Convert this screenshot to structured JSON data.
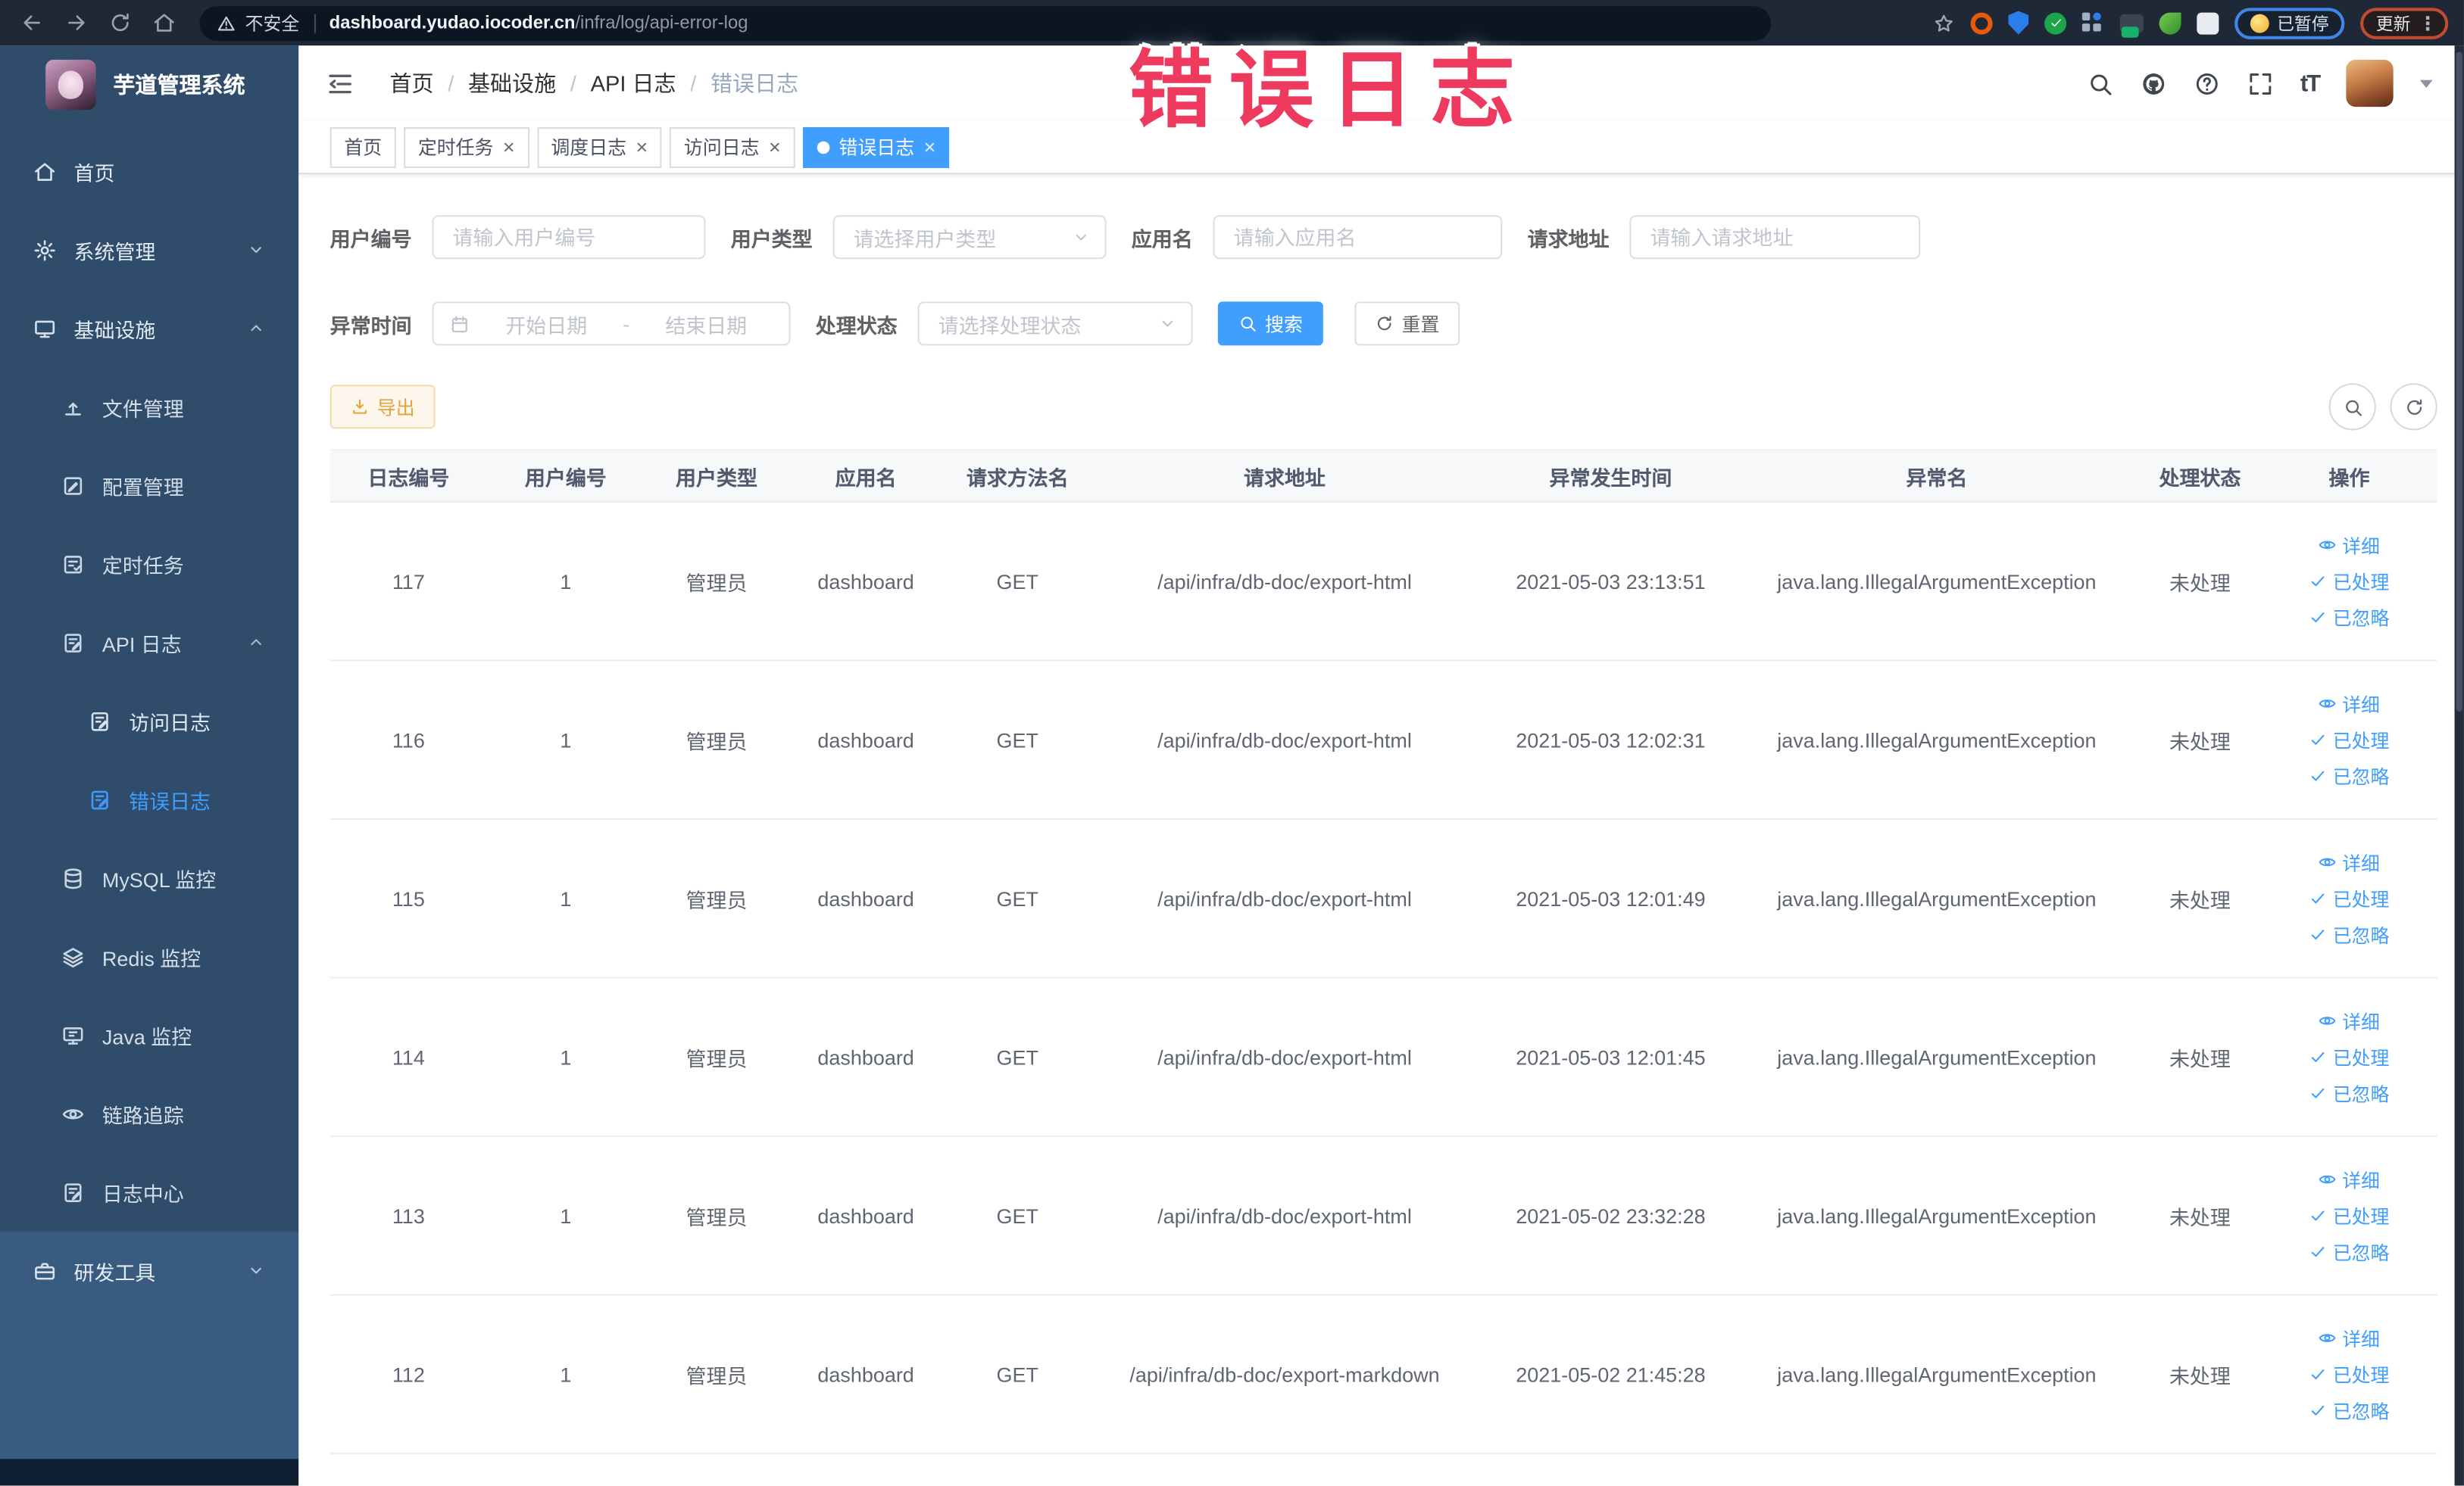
{
  "browser": {
    "security_label": "不安全",
    "url_domain": "dashboard.yudao.iocoder.cn",
    "url_path": "/infra/log/api-error-log",
    "badges": {
      "paused": "已暂停",
      "update": "更新"
    }
  },
  "overlay_text": "错误日志",
  "colors": {
    "accent": "#409eff",
    "warning": "#e6a23c",
    "annotation": "#ee3a5f"
  },
  "sidebar": {
    "logo_title": "芋道管理系统",
    "items": [
      {
        "id": "home",
        "icon": "home-icon",
        "label": "首页",
        "level": 0
      },
      {
        "id": "system",
        "icon": "gear-icon",
        "label": "系统管理",
        "level": 0,
        "chevron": "down"
      },
      {
        "id": "infra",
        "icon": "monitor-icon",
        "label": "基础设施",
        "level": 0,
        "chevron": "up"
      },
      {
        "id": "file",
        "icon": "cloud-upload-icon",
        "label": "文件管理",
        "level": 1
      },
      {
        "id": "config",
        "icon": "edit-icon",
        "label": "配置管理",
        "level": 1
      },
      {
        "id": "job",
        "icon": "task-icon",
        "label": "定时任务",
        "level": 1
      },
      {
        "id": "api-log",
        "icon": "document-edit-icon",
        "label": "API 日志",
        "level": 1,
        "chevron": "up"
      },
      {
        "id": "access-log",
        "icon": "document-edit-icon",
        "label": "访问日志",
        "level": 2
      },
      {
        "id": "error-log",
        "icon": "document-edit-icon",
        "label": "错误日志",
        "level": 2,
        "active": true
      },
      {
        "id": "mysql",
        "icon": "database-icon",
        "label": "MySQL 监控",
        "level": 1
      },
      {
        "id": "redis",
        "icon": "layers-icon",
        "label": "Redis 监控",
        "level": 1
      },
      {
        "id": "java",
        "icon": "java-monitor-icon",
        "label": "Java 监控",
        "level": 1
      },
      {
        "id": "trace",
        "icon": "eye-icon",
        "label": "链路追踪",
        "level": 1
      },
      {
        "id": "log-center",
        "icon": "document-edit-icon",
        "label": "日志中心",
        "level": 1
      },
      {
        "id": "dev-tools",
        "icon": "toolbox-icon",
        "label": "研发工具",
        "level": 0,
        "chevron": "down",
        "section": "lower"
      }
    ]
  },
  "breadcrumb": [
    "首页",
    "基础设施",
    "API 日志",
    "错误日志"
  ],
  "tabs": [
    {
      "label": "首页",
      "closable": false,
      "active": false
    },
    {
      "label": "定时任务",
      "closable": true,
      "active": false
    },
    {
      "label": "调度日志",
      "closable": true,
      "active": false
    },
    {
      "label": "访问日志",
      "closable": true,
      "active": false
    },
    {
      "label": "错误日志",
      "closable": true,
      "active": true
    }
  ],
  "filters": {
    "fields": [
      {
        "label": "用户编号",
        "placeholder": "请输入用户编号",
        "type": "input"
      },
      {
        "label": "用户类型",
        "placeholder": "请选择用户类型",
        "type": "select"
      },
      {
        "label": "应用名",
        "placeholder": "请输入应用名",
        "type": "input"
      },
      {
        "label": "请求地址",
        "placeholder": "请输入请求地址",
        "type": "input"
      },
      {
        "label": "异常时间",
        "type": "daterange",
        "start_placeholder": "开始日期",
        "separator": "-",
        "end_placeholder": "结束日期"
      },
      {
        "label": "处理状态",
        "placeholder": "请选择处理状态",
        "type": "select"
      }
    ],
    "search_label": "搜索",
    "reset_label": "重置"
  },
  "toolbar": {
    "export_label": "导出"
  },
  "table": {
    "headers": [
      "日志编号",
      "用户编号",
      "用户类型",
      "应用名",
      "请求方法名",
      "请求地址",
      "异常发生时间",
      "异常名",
      "处理状态",
      "操作"
    ],
    "action_labels": [
      "详细",
      "已处理",
      "已忽略"
    ],
    "rows": [
      {
        "id": "117",
        "user_id": "1",
        "user_type": "管理员",
        "app": "dashboard",
        "method": "GET",
        "url": "/api/infra/db-doc/export-html",
        "time": "2021-05-03 23:13:51",
        "exception": "java.lang.IllegalArgumentException",
        "status": "未处理"
      },
      {
        "id": "116",
        "user_id": "1",
        "user_type": "管理员",
        "app": "dashboard",
        "method": "GET",
        "url": "/api/infra/db-doc/export-html",
        "time": "2021-05-03 12:02:31",
        "exception": "java.lang.IllegalArgumentException",
        "status": "未处理"
      },
      {
        "id": "115",
        "user_id": "1",
        "user_type": "管理员",
        "app": "dashboard",
        "method": "GET",
        "url": "/api/infra/db-doc/export-html",
        "time": "2021-05-03 12:01:49",
        "exception": "java.lang.IllegalArgumentException",
        "status": "未处理"
      },
      {
        "id": "114",
        "user_id": "1",
        "user_type": "管理员",
        "app": "dashboard",
        "method": "GET",
        "url": "/api/infra/db-doc/export-html",
        "time": "2021-05-03 12:01:45",
        "exception": "java.lang.IllegalArgumentException",
        "status": "未处理"
      },
      {
        "id": "113",
        "user_id": "1",
        "user_type": "管理员",
        "app": "dashboard",
        "method": "GET",
        "url": "/api/infra/db-doc/export-html",
        "time": "2021-05-02 23:32:28",
        "exception": "java.lang.IllegalArgumentException",
        "status": "未处理"
      },
      {
        "id": "112",
        "user_id": "1",
        "user_type": "管理员",
        "app": "dashboard",
        "method": "GET",
        "url": "/api/infra/db-doc/export-markdown",
        "time": "2021-05-02 21:45:28",
        "exception": "java.lang.IllegalArgumentException",
        "status": "未处理"
      }
    ]
  }
}
